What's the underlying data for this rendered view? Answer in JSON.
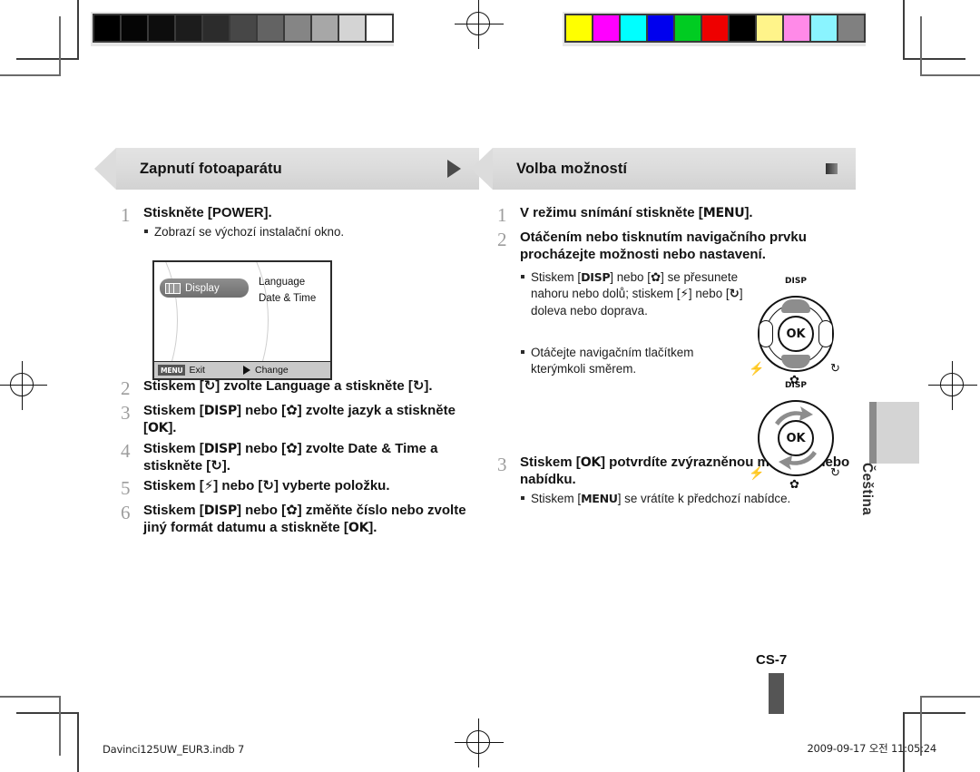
{
  "calibration": {
    "gray_strip": [
      "#000000",
      "#050505",
      "#0d0d0d",
      "#1c1c1c",
      "#2c2c2c",
      "#474747",
      "#636363",
      "#858585",
      "#a7a7a7",
      "#d4d4d4",
      "#ffffff"
    ],
    "color_strip": [
      "#ffff00",
      "#ff00ff",
      "#00ffff",
      "#0000ee",
      "#00cc22",
      "#ee0000",
      "#000000",
      "#fff48a",
      "#ff8ae8",
      "#8af4ff",
      "#808080"
    ]
  },
  "left_panel": {
    "title": "Zapnutí fotoaparátu",
    "header_icon": "play-triangle-icon",
    "steps": [
      {
        "num": "1",
        "text_html": "Stiskněte [<b>POWER</b>].",
        "sub": "Zobrazí se výchozí instalační okno."
      },
      {
        "num": "2",
        "text_html": "Stiskem [<span class=\"kg\">&#8635;</span>] zvolte <b>Language</b> a stiskněte [<span class=\"kg\">&#8635;</span>]."
      },
      {
        "num": "3",
        "text_html": "Stiskem [<span class=\"k\">DISP</span>] nebo [<span class=\"kg\">&#10047;</span>] zvolte jazyk a stiskněte [<span class=\"k\">OK</span>]."
      },
      {
        "num": "4",
        "text_html": "Stiskem [<span class=\"k\">DISP</span>] nebo [<span class=\"kg\">&#10047;</span>] zvolte <b>Date &amp; Time</b> a stiskněte [<span class=\"kg\">&#8635;</span>]."
      },
      {
        "num": "5",
        "text_html": "Stiskem [<span class=\"kg\">&#9889;</span>] nebo [<span class=\"kg\">&#8635;</span>] vyberte položku."
      },
      {
        "num": "6",
        "text_html": "Stiskem [<span class=\"k\">DISP</span>] nebo [<span class=\"kg\">&#10047;</span>] změňte číslo nebo zvolte jiný formát datumu a stiskněte [<span class=\"k\">OK</span>]."
      }
    ],
    "lcd": {
      "tab_label": "Display",
      "menu_items": [
        "Language",
        "Date & Time"
      ],
      "bottom_menu_badge": "MENU",
      "bottom_exit": "Exit",
      "bottom_change": "Change"
    }
  },
  "right_panel": {
    "title": "Volba možností",
    "header_icon": "square-icon",
    "steps": [
      {
        "num": "1",
        "text_html": "V režimu snímání stiskněte [<span class=\"k\">MENU</span>]."
      },
      {
        "num": "2",
        "text_html": "Otáčením nebo tisknutím navigačního prvku procházejte možnosti nebo nastavení.",
        "subs_html": [
          "Stiskem [<span class=\"k\">DISP</span>] nebo [<span class=\"kg\">&#10047;</span>] se přesunete nahoru nebo dolů; stiskem [<span class=\"kg\">&#9889;</span>] nebo [<span class=\"kg\">&#8635;</span>] doleva nebo doprava.",
          "Otáčejte navigačním tlačítkem kterýmkoli směrem."
        ]
      },
      {
        "num": "3",
        "text_html": "Stiskem [<span class=\"k\">OK</span>] potvrdíte zvýrazněnou možnost nebo nabídku.",
        "subs_html": [
          "Stiskem [<span class=\"k\">MENU</span>] se vrátíte k předchozí nabídce."
        ]
      }
    ],
    "wheels": {
      "disp_label": "DISP",
      "ok_label": "OK",
      "flash_icon": "flash-icon",
      "timer_icon": "self-timer-icon",
      "macro_icon": "macro-flower-icon"
    }
  },
  "side_tab_label": "Čeština",
  "page_number": "CS-7",
  "footer": {
    "left": "Davinci125UW_EUR3.indb   7",
    "right": "2009-09-17   오전 11:05:24"
  }
}
